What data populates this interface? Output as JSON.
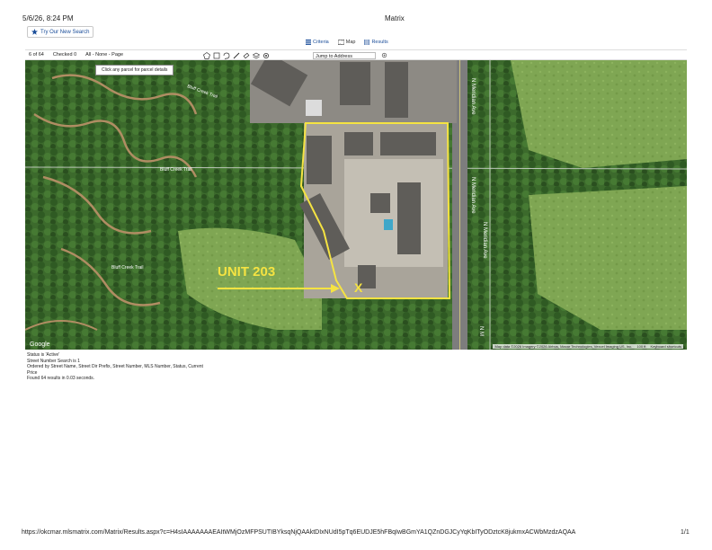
{
  "header": {
    "datetime": "5/6/26, 8:24 PM",
    "title": "Matrix"
  },
  "search_button": {
    "label": "Try Our New Search"
  },
  "view_tabs": [
    {
      "label": "Criteria",
      "icon": "criteria-icon"
    },
    {
      "label": "Map",
      "icon": "map-icon"
    },
    {
      "label": "Results",
      "icon": "results-icon"
    }
  ],
  "toolbar": {
    "count": "6 of 64",
    "checked": "Checked 0",
    "select": "All - None - Page",
    "jump_label": "Jump to Address",
    "tools": [
      "polygon-icon",
      "square-icon",
      "lasso-icon",
      "pen-icon",
      "eraser-icon",
      "layers-icon",
      "settings-icon"
    ]
  },
  "map": {
    "tooltip": "Click any parcel for parcel details",
    "annotation": "UNIT 203",
    "marker": "X",
    "roads": [
      "N Meridian Ave",
      "N Meridian Ave",
      "N Meridian Ave",
      "N M",
      "Bluff Creek Trail",
      "Bluff Creek Trail",
      "Bluff Creek Trail"
    ],
    "google": "Google",
    "attribution": "Map data ©2026 Imagery ©2026 Airbus, Maxar Technologies, Vexcel Imaging US, Inc.",
    "scale": "100 ft",
    "shortcuts": "Keyboard shortcuts"
  },
  "footer_info": [
    "Status is 'Active'",
    "Street Number Search is 1",
    "Ordered by Street Name, Street Dir Prefix, Street Number, MLS Number, Status, Current",
    "Price",
    "Found 64 results in 0.03 seconds."
  ],
  "footer": {
    "url": "https://okcmar.mlsmatrix.com/Matrix/Results.aspx?c=H4sIAAAAAAAEAItWMjOzMFPSUTIBYksqNjQAAktDIxNUdI5pTq6EUDJE5hFBqIwBGmYA1QZnDGJCyYqKbITyODztcK8jukmxACWbMzdzAQAA",
    "page": "1/1"
  },
  "colors": {
    "link": "#1a4d99",
    "boundary": "#f5e342"
  }
}
